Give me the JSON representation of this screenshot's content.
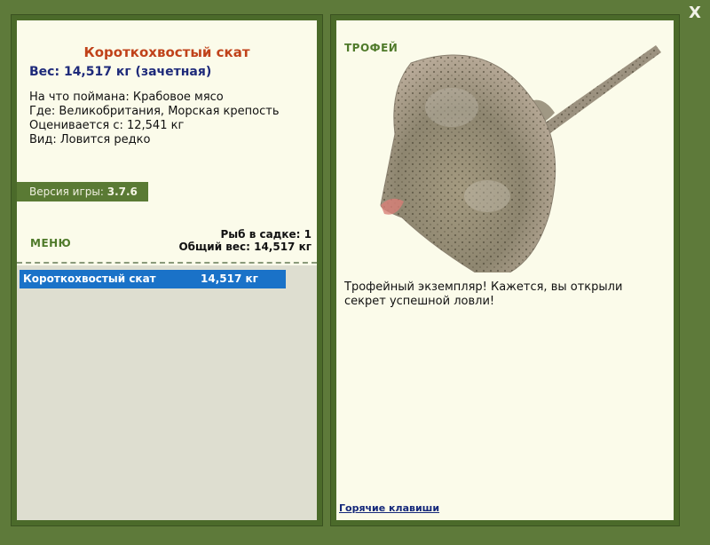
{
  "window": {
    "close_label": "X"
  },
  "fish": {
    "name": "Короткохвостый скат",
    "weight_label": "Вес:",
    "weight_value": "14,517 кг",
    "weight_note": "(зачетная)",
    "details": [
      "На что поймана: Крабовое мясо",
      "Где: Великобритания, Морская крепость",
      "Оценивается с: 12,541 кг",
      "Вид: Ловится редко"
    ]
  },
  "version": {
    "label": "Версия игры:",
    "value": "3.7.6"
  },
  "menu": {
    "label": "МЕНЮ"
  },
  "keepnet": {
    "count_text": "Рыб в садке: 1",
    "total_text": "Общий вес: 14,517 кг"
  },
  "catch_list": [
    {
      "name": "Короткохвостый скат",
      "weight": "14,517 кг",
      "selected": true
    }
  ],
  "trophy": {
    "label": "ТРОФЕЙ",
    "text": "Трофейный экземпляр! Кажется, вы открыли секрет успешной ловли!"
  },
  "footer": {
    "hotkeys_label": "Горячие клавиши"
  },
  "colors": {
    "frame": "#5e7a3a",
    "panel_bg": "#fbfbea",
    "title": "#c0421a",
    "weight": "#1e2a7a",
    "selection": "#1a72c8"
  }
}
